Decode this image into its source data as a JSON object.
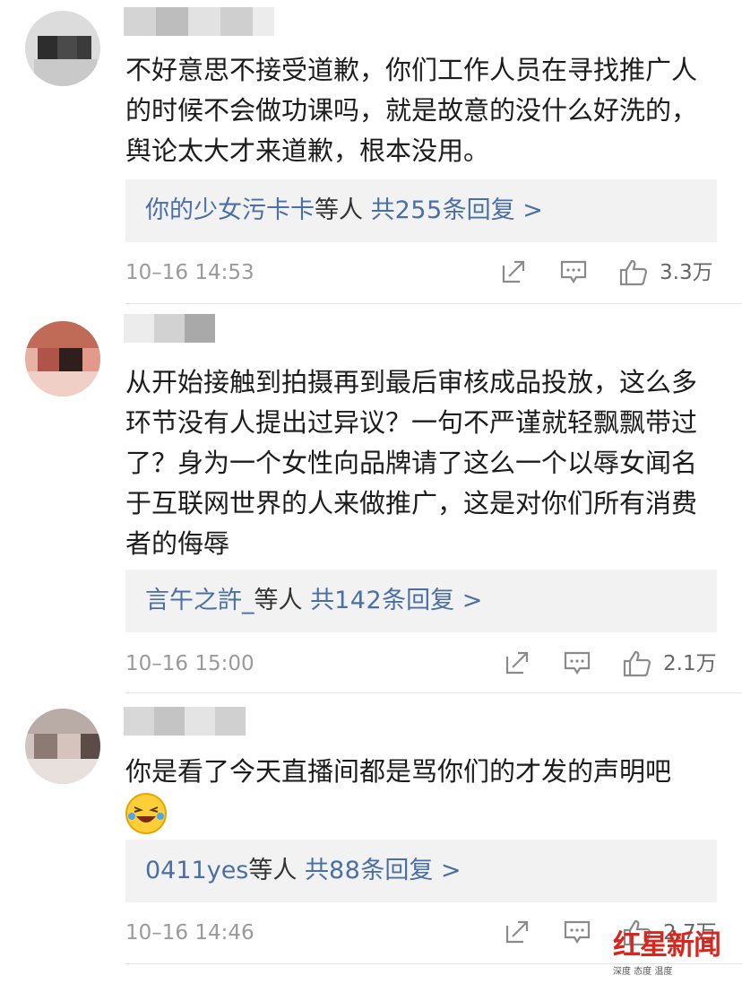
{
  "comments": [
    {
      "text": "不好意思不接受道歉，你们工作人员在寻找推广人的时候不会做功课吗，就是故意的没什么好洗的，舆论太大才来道歉，根本没用。",
      "reply": {
        "names": "你的少女污卡卡",
        "etc": "等人",
        "prefix": "共",
        "count": "255",
        "suffix": "条回复 >"
      },
      "time": "10–16 14:53",
      "likes": "3.3万"
    },
    {
      "text": "从开始接触到拍摄再到最后审核成品投放，这么多环节没有人提出过异议？一句不严谨就轻飘飘带过了？身为一个女性向品牌请了这么一个以辱女闻名于互联网世界的人来做推广，这是对你们所有消费者的侮辱",
      "reply": {
        "names": "言午之許_",
        "etc": "等人",
        "prefix": "共",
        "count": "142",
        "suffix": "条回复 >"
      },
      "time": "10–16 15:00",
      "likes": "2.1万"
    },
    {
      "text": "你是看了今天直播间都是骂你们的才发的声明吧",
      "reply": {
        "names": "0411yes",
        "etc": "等人",
        "prefix": "共",
        "count": "88",
        "suffix": "条回复 >"
      },
      "time": "10–16 14:46",
      "likes": "2.7万"
    }
  ],
  "watermark": {
    "main": "红星新闻",
    "sub": "深度 态度 温度"
  },
  "colors": {
    "link": "#4a6fa5",
    "reply_bg": "#f2f2f2",
    "meta": "#9a9a9a",
    "brand_red": "#d7261e"
  },
  "icons": [
    "share-icon",
    "comment-icon",
    "like-icon",
    "laughing-emoji-icon"
  ]
}
